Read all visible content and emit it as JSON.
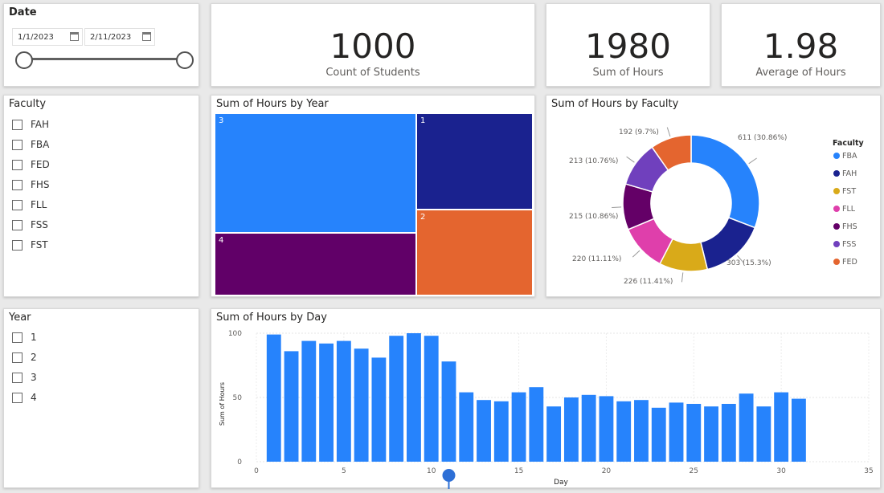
{
  "date_slicer": {
    "title": "Date",
    "start_date": "1/1/2023",
    "end_date": "2/11/2023"
  },
  "kpis": [
    {
      "value": "1000",
      "label": "Count of Students"
    },
    {
      "value": "1980",
      "label": "Sum of Hours"
    },
    {
      "value": "1.98",
      "label": "Average of Hours"
    }
  ],
  "faculty_slicer": {
    "title": "Faculty",
    "items": [
      "FAH",
      "FBA",
      "FED",
      "FHS",
      "FLL",
      "FSS",
      "FST"
    ]
  },
  "year_slicer": {
    "title": "Year",
    "items": [
      "1",
      "2",
      "3",
      "4"
    ]
  },
  "colors": {
    "fba": "#2683fc",
    "fah": "#1a228f",
    "fst": "#d9aa19",
    "fll": "#df3fab",
    "fhs": "#640067",
    "fss": "#7040bd",
    "fed": "#e4652f",
    "year3": "#2683fc",
    "year1": "#1a228f",
    "year4": "#610068",
    "year2": "#e4652f",
    "bar": "#2683fc"
  },
  "chart_data": [
    {
      "type": "treemap",
      "title": "Sum of Hours by Year",
      "items": [
        {
          "label": "3",
          "value": 760,
          "color": "#2683fc"
        },
        {
          "label": "1",
          "value": 390,
          "color": "#1a228f"
        },
        {
          "label": "4",
          "value": 455,
          "color": "#610068"
        },
        {
          "label": "2",
          "value": 375,
          "color": "#e4652f"
        }
      ]
    },
    {
      "type": "pie",
      "title": "Sum of Hours by Faculty",
      "legend_title": "Faculty",
      "legend_position": "right",
      "slices": [
        {
          "label": "FBA",
          "value": 611,
          "pct": "30.86%",
          "data_label": "611 (30.86%)",
          "color": "#2683fc"
        },
        {
          "label": "FAH",
          "value": 303,
          "pct": "15.3%",
          "data_label": "303 (15.3%)",
          "color": "#1a228f"
        },
        {
          "label": "FST",
          "value": 226,
          "pct": "11.41%",
          "data_label": "226 (11.41%)",
          "color": "#d9aa19"
        },
        {
          "label": "FLL",
          "value": 220,
          "pct": "11.11%",
          "data_label": "220 (11.11%)",
          "color": "#df3fab"
        },
        {
          "label": "FHS",
          "value": 215,
          "pct": "10.86%",
          "data_label": "215 (10.86%)",
          "color": "#640067"
        },
        {
          "label": "FSS",
          "value": 213,
          "pct": "10.76%",
          "data_label": "213 (10.76%)",
          "color": "#7040bd"
        },
        {
          "label": "FED",
          "value": 192,
          "pct": "9.7%",
          "data_label": "192 (9.7%)",
          "color": "#e4652f"
        }
      ]
    },
    {
      "type": "bar",
      "title": "Sum of Hours by Day",
      "xlabel": "Day",
      "ylabel": "Sum of Hours",
      "xlim": [
        0,
        35
      ],
      "ylim": [
        0,
        100
      ],
      "x_ticks": [
        0,
        5,
        10,
        15,
        20,
        25,
        30,
        35
      ],
      "y_ticks": [
        0,
        50,
        100
      ],
      "grid": true,
      "categories": [
        1,
        2,
        3,
        4,
        5,
        6,
        7,
        8,
        9,
        10,
        11,
        12,
        13,
        14,
        15,
        16,
        17,
        18,
        19,
        20,
        21,
        22,
        23,
        24,
        25,
        26,
        27,
        28,
        29,
        30,
        31
      ],
      "values": [
        99,
        86,
        94,
        92,
        94,
        88,
        81,
        98,
        100,
        98,
        78,
        54,
        48,
        47,
        54,
        58,
        43,
        50,
        52,
        51,
        47,
        48,
        42,
        46,
        45,
        43,
        45,
        53,
        43,
        54,
        49
      ],
      "playhead_day": 11
    }
  ]
}
